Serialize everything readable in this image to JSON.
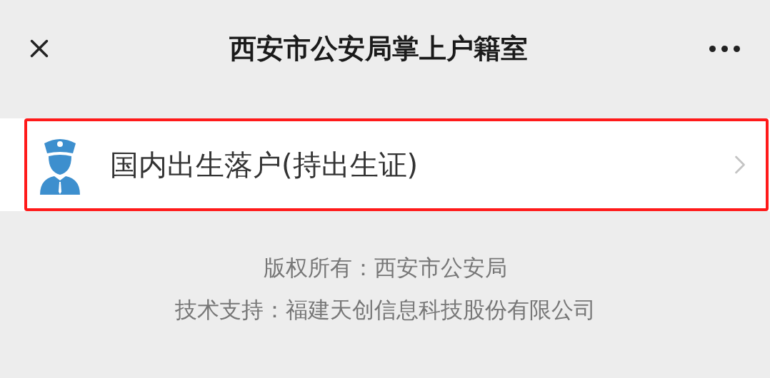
{
  "header": {
    "title": "西安市公安局掌上户籍室"
  },
  "menu_items": [
    {
      "label": "国内出生落户(持出生证)",
      "highlighted": true
    }
  ],
  "footer": {
    "lines": [
      "版权所有：西安市公安局",
      "技术支持：福建天创信息科技股份有限公司"
    ]
  }
}
